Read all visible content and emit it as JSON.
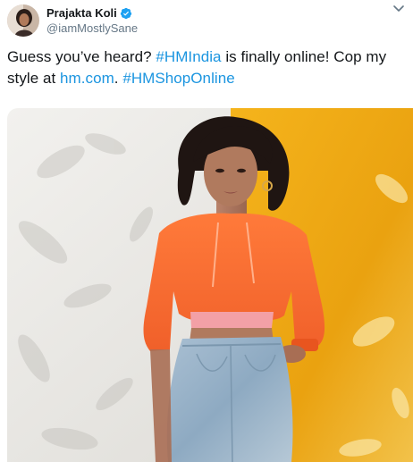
{
  "tweet": {
    "author": {
      "display_name": "Prajakta Koli",
      "handle": "@iamMostlySane",
      "verified": true,
      "avatar_icon": "profile-photo"
    },
    "menu_icon": "chevron-down-icon",
    "text": {
      "part1": "Guess you’ve heard? ",
      "hashtag1": "#HMIndia",
      "part2": " is finally online! Cop my style at ",
      "link": "hm.com",
      "part3": ". ",
      "hashtag2": "#HMShopOnline"
    },
    "media": {
      "kind": "photo",
      "subject": "person in orange cropped hoodie and denim skirt against white and yellow wall"
    }
  },
  "colors": {
    "link": "#1b95e0",
    "text": "#14171a",
    "secondary": "#657786",
    "verified_badge": "#1da1f2"
  }
}
